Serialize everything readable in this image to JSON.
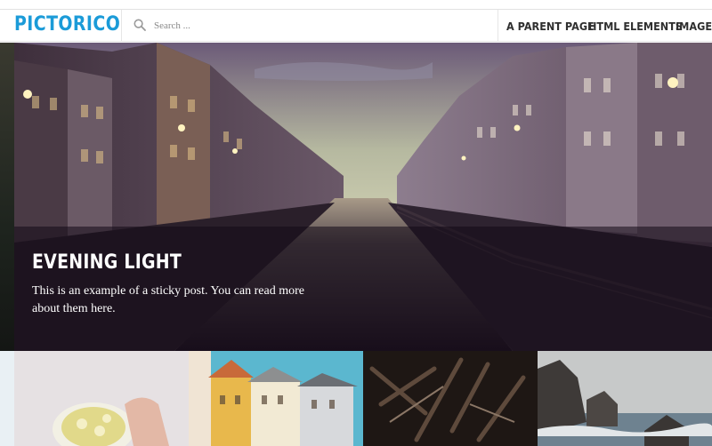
{
  "site": {
    "logo": "PICTORICO"
  },
  "search": {
    "placeholder": "Search ...",
    "value": ""
  },
  "nav": {
    "items": [
      "A PARENT PAGE",
      "HTML ELEMENTS",
      "IMAGES"
    ]
  },
  "hero": {
    "title": "EVENING LIGHT",
    "excerpt": "This is an example of a sticky post. You can read more about them here."
  },
  "thumbnails": [
    "tea-cup",
    "colorful-houses",
    "tools",
    "sea-rocks"
  ],
  "colors": {
    "brand": "#1b9bd8",
    "nav_text": "#2f2f2f"
  }
}
